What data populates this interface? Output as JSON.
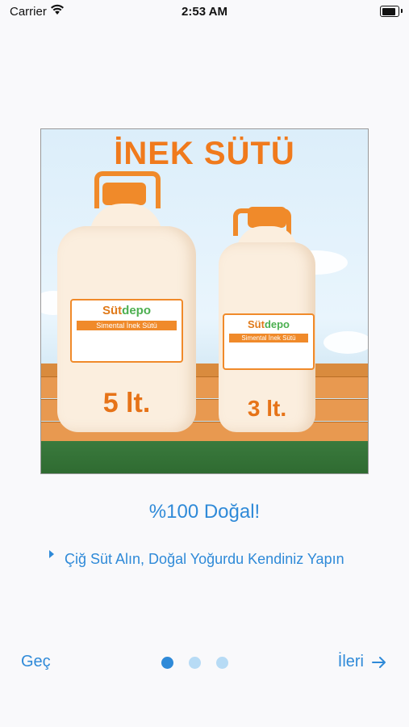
{
  "status_bar": {
    "carrier": "Carrier",
    "time": "2:53 AM",
    "battery_level": 1.0
  },
  "product_image": {
    "headline": "İNEK SÜTÜ",
    "left_bottle": {
      "brand_prefix": "Süt",
      "brand_suffix": "depo",
      "label_text": "Simental İnek Sütü",
      "volume": "5 lt."
    },
    "right_bottle": {
      "brand_prefix": "Süt",
      "brand_suffix": "depo",
      "label_text": "Simental İnek Sütü",
      "volume": "3 lt."
    }
  },
  "onboarding": {
    "title": "%100 Doğal!",
    "description": "Çiğ Süt Alın, Doğal Yoğurdu Kendiniz Yapın"
  },
  "navigation": {
    "skip_label": "Geç",
    "next_label": "İleri",
    "page_count": 3,
    "current_page": 1
  },
  "colors": {
    "accent": "#2f8ad8",
    "dot_inactive": "#b7dbf5",
    "brand_orange": "#f07a1c"
  }
}
